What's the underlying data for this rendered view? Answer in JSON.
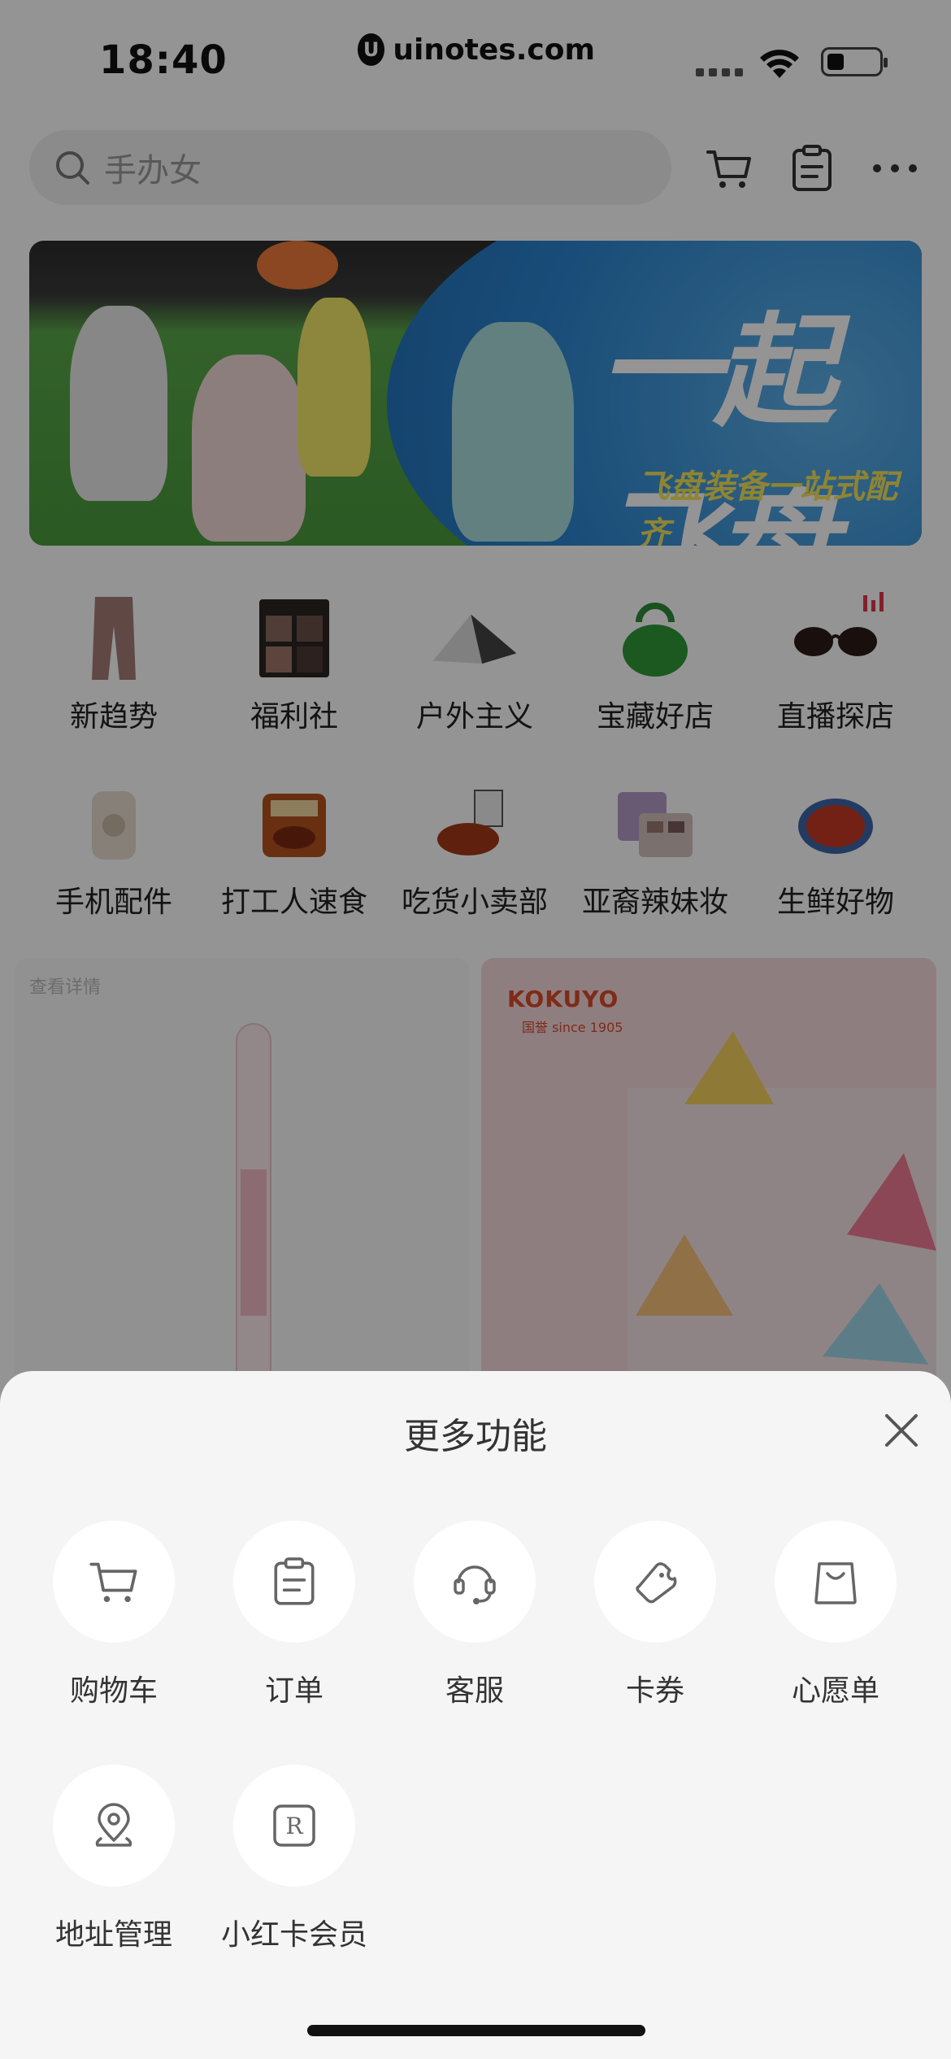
{
  "status_bar": {
    "time": "18:40",
    "url": "uinotes.com"
  },
  "search": {
    "placeholder": "手办女"
  },
  "top_icons": [
    "cart-icon",
    "clipboard-icon",
    "more-icon"
  ],
  "banner": {
    "title": "一起飞盘",
    "subtitle": "飞盘装备一站式配齐"
  },
  "categories": [
    {
      "label": "新趋势",
      "icon": "pants-icon"
    },
    {
      "label": "福利社",
      "icon": "eyeshadow-palette-icon"
    },
    {
      "label": "户外主义",
      "icon": "tent-icon"
    },
    {
      "label": "宝藏好店",
      "icon": "green-bag-icon"
    },
    {
      "label": "直播探店",
      "icon": "sunglasses-icon"
    },
    {
      "label": "手机配件",
      "icon": "power-bank-icon"
    },
    {
      "label": "打工人速食",
      "icon": "instant-food-icon"
    },
    {
      "label": "吃货小卖部",
      "icon": "noodles-icon"
    },
    {
      "label": "亚裔辣妹妆",
      "icon": "makeup-palette-icon"
    },
    {
      "label": "生鲜好物",
      "icon": "seafood-plate-icon"
    }
  ],
  "products": {
    "left_tag": "查看详情",
    "right_brand": "KOKUYO",
    "right_brand_sub": "国誉 since 1905"
  },
  "sheet": {
    "title": "更多功能",
    "items": [
      {
        "label": "购物车",
        "icon": "cart-icon"
      },
      {
        "label": "订单",
        "icon": "clipboard-icon"
      },
      {
        "label": "客服",
        "icon": "headset-icon"
      },
      {
        "label": "卡券",
        "icon": "ticket-icon"
      },
      {
        "label": "心愿单",
        "icon": "bag-icon"
      },
      {
        "label": "地址管理",
        "icon": "location-pin-icon"
      },
      {
        "label": "小红卡会员",
        "icon": "registered-icon"
      }
    ]
  }
}
